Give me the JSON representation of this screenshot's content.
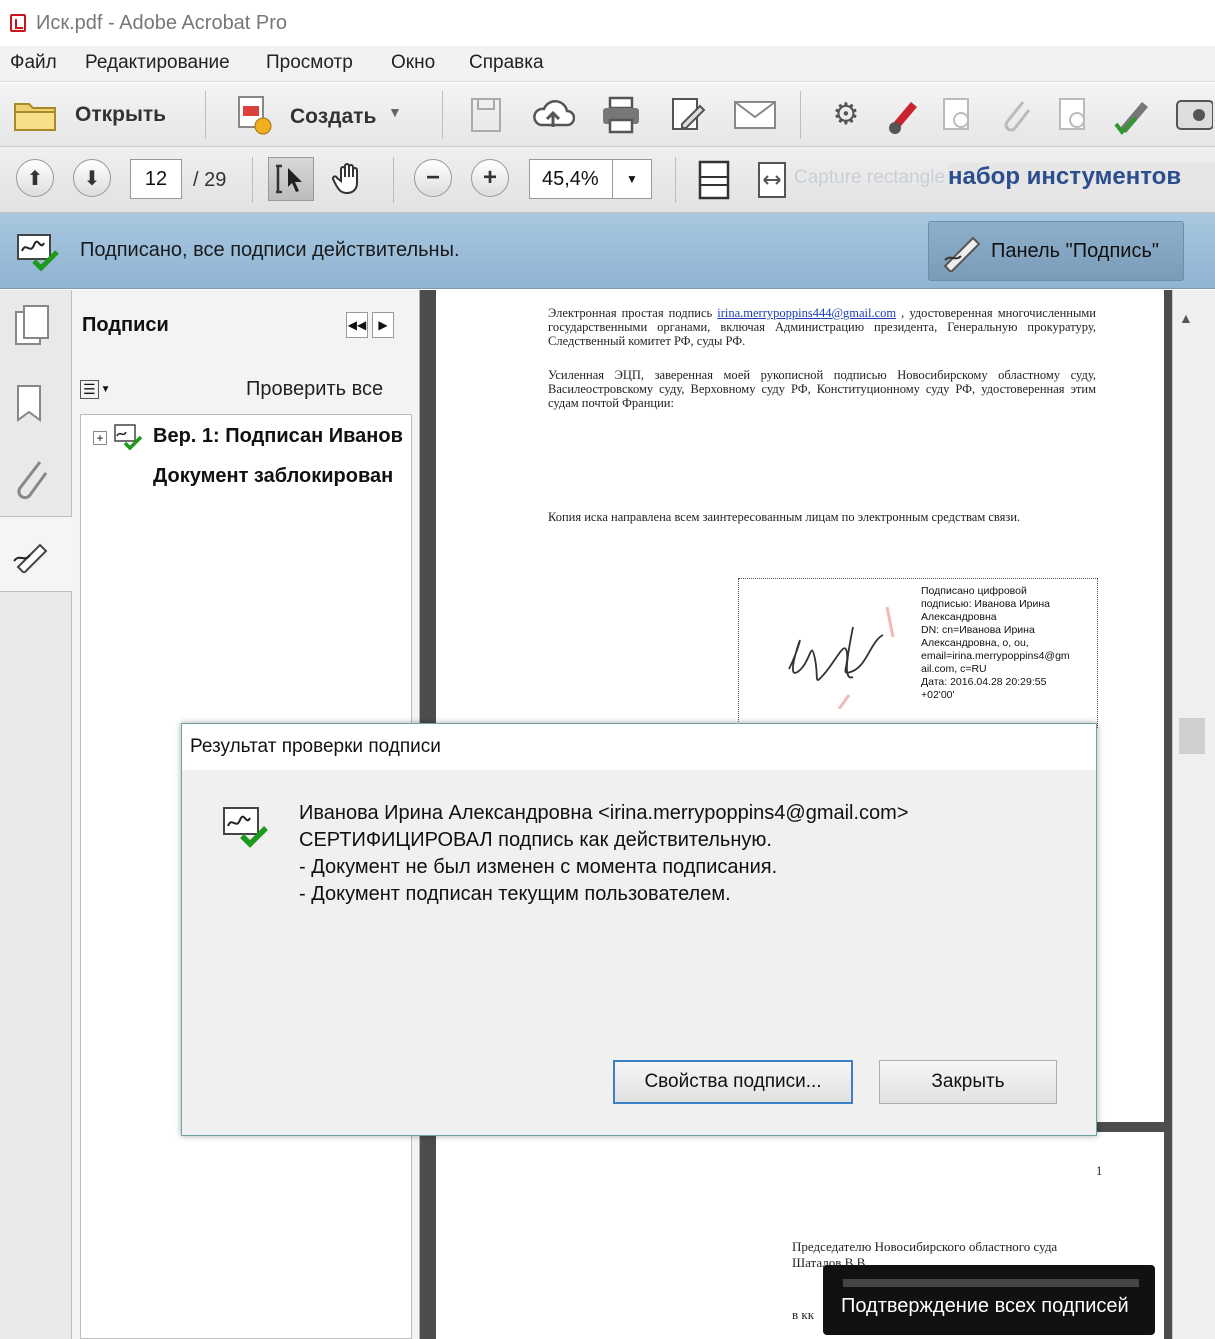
{
  "window": {
    "title": "Иск.pdf - Adobe Acrobat Pro"
  },
  "menu": [
    "Файл",
    "Редактирование",
    "Просмотр",
    "Окно",
    "Справка"
  ],
  "toolbar": {
    "open_label": "Открыть",
    "create_label": "Создать"
  },
  "nav": {
    "current_page": "12",
    "total_pages": "/ 29",
    "zoom": "45,4%",
    "capture_label": "Capture rectangle",
    "tools_label": "набор инстументов"
  },
  "signbar": {
    "message": "Подписано, все подписи действительны.",
    "panel_button": "Панель \"Подпись\""
  },
  "sigpanel": {
    "header": "Подписи",
    "verify_all": "Проверить все",
    "tree": {
      "item1": "Вер. 1: Подписан Иванов",
      "item2": "Документ заблокирован"
    }
  },
  "document": {
    "p1_para1_pre": "Электронная простая подпись ",
    "p1_para1_link": "irina.merrypoppins444@gmail.com",
    "p1_para1_post": " , удостоверенная многочисленными государственными органами, включая Администрацию президента, Генеральную прокуратуру, Следственный комитет РФ, суды РФ.",
    "p1_para2": "Усиленная ЭЦП, заверенная моей рукописной подписью Новосибирскому областному суду, Василеостровскому суду, Верховному суду РФ, Конституционному суду РФ, удостоверенная этим судам почтой Франции:",
    "p1_para3": "Копия иска направлена всем заинтересованным лицам по электронным средствам связи.",
    "stamp": [
      "Подписано цифровой",
      "подписью: Иванова Ирина",
      "Александровна",
      "DN: cn=Иванова Ирина",
      "Александровна, o, ou,",
      "email=irina.merrypoppins4@gm",
      "ail.com, c=RU",
      "Дата: 2016.04.28 20:29:55",
      "+02'00'"
    ],
    "p2_page_number": "1",
    "p2_addressee_1": "Председателю Новосибирского областного суда",
    "p2_addressee_2": "Шаталов В.В.",
    "p2_fragment": "в кк"
  },
  "dialog": {
    "title": "Результат проверки подписи",
    "line1": "Иванова  Ирина Александровна <irina.merrypoppins4@gmail.com>",
    "line2": "СЕРТИФИЦИРОВАЛ подпись как действительную.",
    "line3": "- Документ  не был изменен с момента подписания.",
    "line4": "- Документ подписан текущим пользователем.",
    "properties_button": "Свойства подписи...",
    "close_button": "Закрыть"
  },
  "tooltip": {
    "text": "Подтверждение всех подписей"
  },
  "colors": {
    "signbar": "#9fbfd9",
    "dialog_border": "#6fa5a5",
    "link": "#1a3fb0"
  }
}
